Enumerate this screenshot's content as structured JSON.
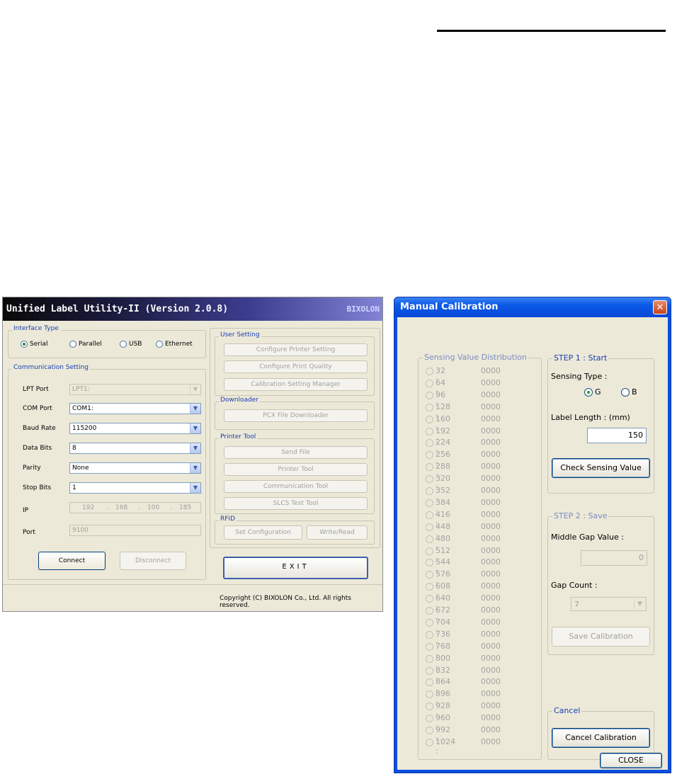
{
  "utility": {
    "title": "Unified Label Utility-II (Version 2.0.8)",
    "brand": "BIXOLON",
    "interface_type": {
      "legend": "Interface Type",
      "options": [
        {
          "label": "Serial",
          "selected": true
        },
        {
          "label": "Parallel",
          "selected": false
        },
        {
          "label": "USB",
          "selected": false
        },
        {
          "label": "Ethernet",
          "selected": false
        }
      ]
    },
    "communication": {
      "legend": "Communication Setting",
      "lpt_port": {
        "label": "LPT Port",
        "value": "LPT1:"
      },
      "com_port": {
        "label": "COM Port",
        "value": "COM1:"
      },
      "baud_rate": {
        "label": "Baud Rate",
        "value": "115200"
      },
      "data_bits": {
        "label": "Data Bits",
        "value": "8"
      },
      "parity": {
        "label": "Parity",
        "value": "None"
      },
      "stop_bits": {
        "label": "Stop Bits",
        "value": "1"
      },
      "ip": {
        "label": "IP",
        "parts": [
          "192",
          "168",
          "100",
          "185"
        ],
        "dot": "."
      },
      "port": {
        "label": "Port",
        "value": "9100"
      },
      "connect_label": "Connect",
      "disconnect_label": "Disconnect"
    },
    "user_setting": {
      "legend": "User Setting",
      "configure_printer_label": "Configure Printer Setting",
      "configure_quality_label": "Configure Print Quality",
      "calibration_manager_label": "Calibration Setting Manager"
    },
    "downloader": {
      "legend": "Downloader",
      "pcx_label": "PCX File Downloader"
    },
    "printer_tool": {
      "legend": "Printer Tool",
      "send_file_label": "Send File",
      "printer_tool_label": "Printer Tool",
      "communication_tool_label": "Communication Tool",
      "slcs_label": "SLCS Test Tool"
    },
    "rfid": {
      "legend": "RFID",
      "set_config_label": "Set Configuration",
      "write_read_label": "Write/Read"
    },
    "exit_label": "EXIT",
    "copyright": "Copyright (C) BIXOLON Co., Ltd. All rights reserved."
  },
  "calibration": {
    "title": "Manual Calibration",
    "close_x": "✕",
    "distribution": {
      "legend": "Sensing Value Distribution",
      "rows": [
        {
          "key": "32 :",
          "value": "0000"
        },
        {
          "key": "64 :",
          "value": "0000"
        },
        {
          "key": "96 :",
          "value": "0000"
        },
        {
          "key": "128 :",
          "value": "0000"
        },
        {
          "key": "160 :",
          "value": "0000"
        },
        {
          "key": "192 :",
          "value": "0000"
        },
        {
          "key": "224 :",
          "value": "0000"
        },
        {
          "key": "256 :",
          "value": "0000"
        },
        {
          "key": "288 :",
          "value": "0000"
        },
        {
          "key": "320 :",
          "value": "0000"
        },
        {
          "key": "352 :",
          "value": "0000"
        },
        {
          "key": "384 :",
          "value": "0000"
        },
        {
          "key": "416 :",
          "value": "0000"
        },
        {
          "key": "448 :",
          "value": "0000"
        },
        {
          "key": "480 :",
          "value": "0000"
        },
        {
          "key": "512 :",
          "value": "0000"
        },
        {
          "key": "544 :",
          "value": "0000"
        },
        {
          "key": "576 :",
          "value": "0000"
        },
        {
          "key": "608 :",
          "value": "0000"
        },
        {
          "key": "640 :",
          "value": "0000"
        },
        {
          "key": "672 :",
          "value": "0000"
        },
        {
          "key": "704 :",
          "value": "0000"
        },
        {
          "key": "736 :",
          "value": "0000"
        },
        {
          "key": "768 :",
          "value": "0000"
        },
        {
          "key": "800 :",
          "value": "0000"
        },
        {
          "key": "832 :",
          "value": "0000"
        },
        {
          "key": "864 :",
          "value": "0000"
        },
        {
          "key": "896 :",
          "value": "0000"
        },
        {
          "key": "928 :",
          "value": "0000"
        },
        {
          "key": "960 :",
          "value": "0000"
        },
        {
          "key": "992 :",
          "value": "0000"
        },
        {
          "key": "1024 :",
          "value": "0000"
        }
      ]
    },
    "step1": {
      "legend": "STEP 1 : Start",
      "sensing_type_label": "Sensing Type :",
      "options": [
        {
          "label": "G",
          "selected": true
        },
        {
          "label": "B",
          "selected": false
        }
      ],
      "label_length_label": "Label Length : (mm)",
      "label_length_value": "150",
      "check_label": "Check Sensing Value"
    },
    "step2": {
      "legend": "STEP 2 : Save",
      "middle_gap_label": "Middle Gap Value :",
      "middle_gap_value": "0",
      "gap_count_label": "Gap Count :",
      "gap_count_value": "7",
      "save_label": "Save Calibration"
    },
    "cancel": {
      "legend": "Cancel",
      "cancel_label": "Cancel Calibration"
    },
    "close_label": "CLOSE"
  }
}
